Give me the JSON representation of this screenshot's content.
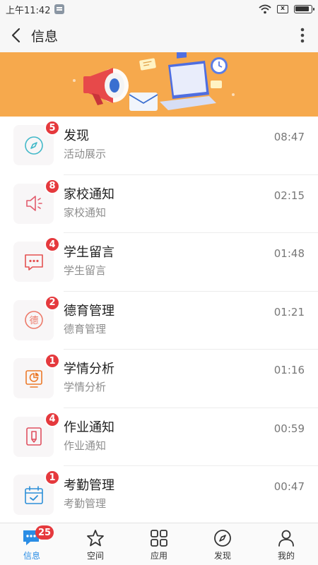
{
  "status_bar": {
    "time": "上午11:42",
    "sim_label": "x"
  },
  "header": {
    "title": "信息"
  },
  "colors": {
    "accent": "#2a8de5",
    "badge": "#e5393d",
    "banner": "#f6a94d"
  },
  "items": [
    {
      "title": "发现",
      "subtitle": "活动展示",
      "time": "08:47",
      "badge": "5",
      "icon": "compass-icon"
    },
    {
      "title": "家校通知",
      "subtitle": "家校通知",
      "time": "02:15",
      "badge": "8",
      "icon": "speaker-icon"
    },
    {
      "title": "学生留言",
      "subtitle": "学生留言",
      "time": "01:48",
      "badge": "4",
      "icon": "chat-dots-icon"
    },
    {
      "title": "德育管理",
      "subtitle": "德育管理",
      "time": "01:21",
      "badge": "2",
      "icon": "de-badge-icon",
      "icon_text": "德"
    },
    {
      "title": "学情分析",
      "subtitle": "学情分析",
      "time": "01:16",
      "badge": "1",
      "icon": "pie-board-icon"
    },
    {
      "title": "作业通知",
      "subtitle": "作业通知",
      "time": "00:59",
      "badge": "4",
      "icon": "pencil-doc-icon"
    },
    {
      "title": "考勤管理",
      "subtitle": "考勤管理",
      "time": "00:47",
      "badge": "1",
      "icon": "calendar-check-icon"
    }
  ],
  "tabbar": {
    "tabs": [
      {
        "label": "信息",
        "badge": "25",
        "icon": "chat-icon",
        "active": true
      },
      {
        "label": "空间",
        "icon": "star-icon"
      },
      {
        "label": "应用",
        "icon": "grid-icon"
      },
      {
        "label": "发现",
        "icon": "compass-icon"
      },
      {
        "label": "我的",
        "icon": "user-icon"
      }
    ]
  }
}
